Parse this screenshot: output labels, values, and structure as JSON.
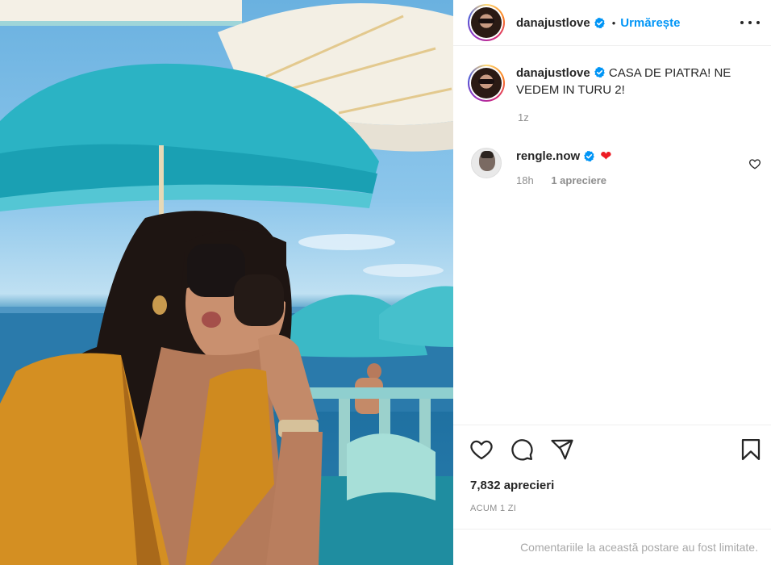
{
  "post": {
    "author": "danajustlove",
    "follow_label": "Urmărește",
    "separator": "•",
    "caption": "CASA DE PIATRA! NE VEDEM IN TURU 2!",
    "caption_age": "1z",
    "likes_text": "7,832 aprecieri",
    "date_text": "ACUM 1 ZI",
    "comments_limited": "Comentariile la această postare au fost limitate."
  },
  "comments": [
    {
      "username": "rengle.now",
      "emoji": "❤",
      "age": "18h",
      "likes": "1 apreciere"
    }
  ],
  "icons": {
    "verified": "verified-badge-icon",
    "more": "more-options-icon",
    "like": "heart-icon",
    "comment": "comment-icon",
    "share": "share-icon",
    "save": "bookmark-icon"
  },
  "colors": {
    "accent": "#0095f6",
    "text": "#262626",
    "muted": "#8e8e8e",
    "heart": "#ed1c24"
  }
}
